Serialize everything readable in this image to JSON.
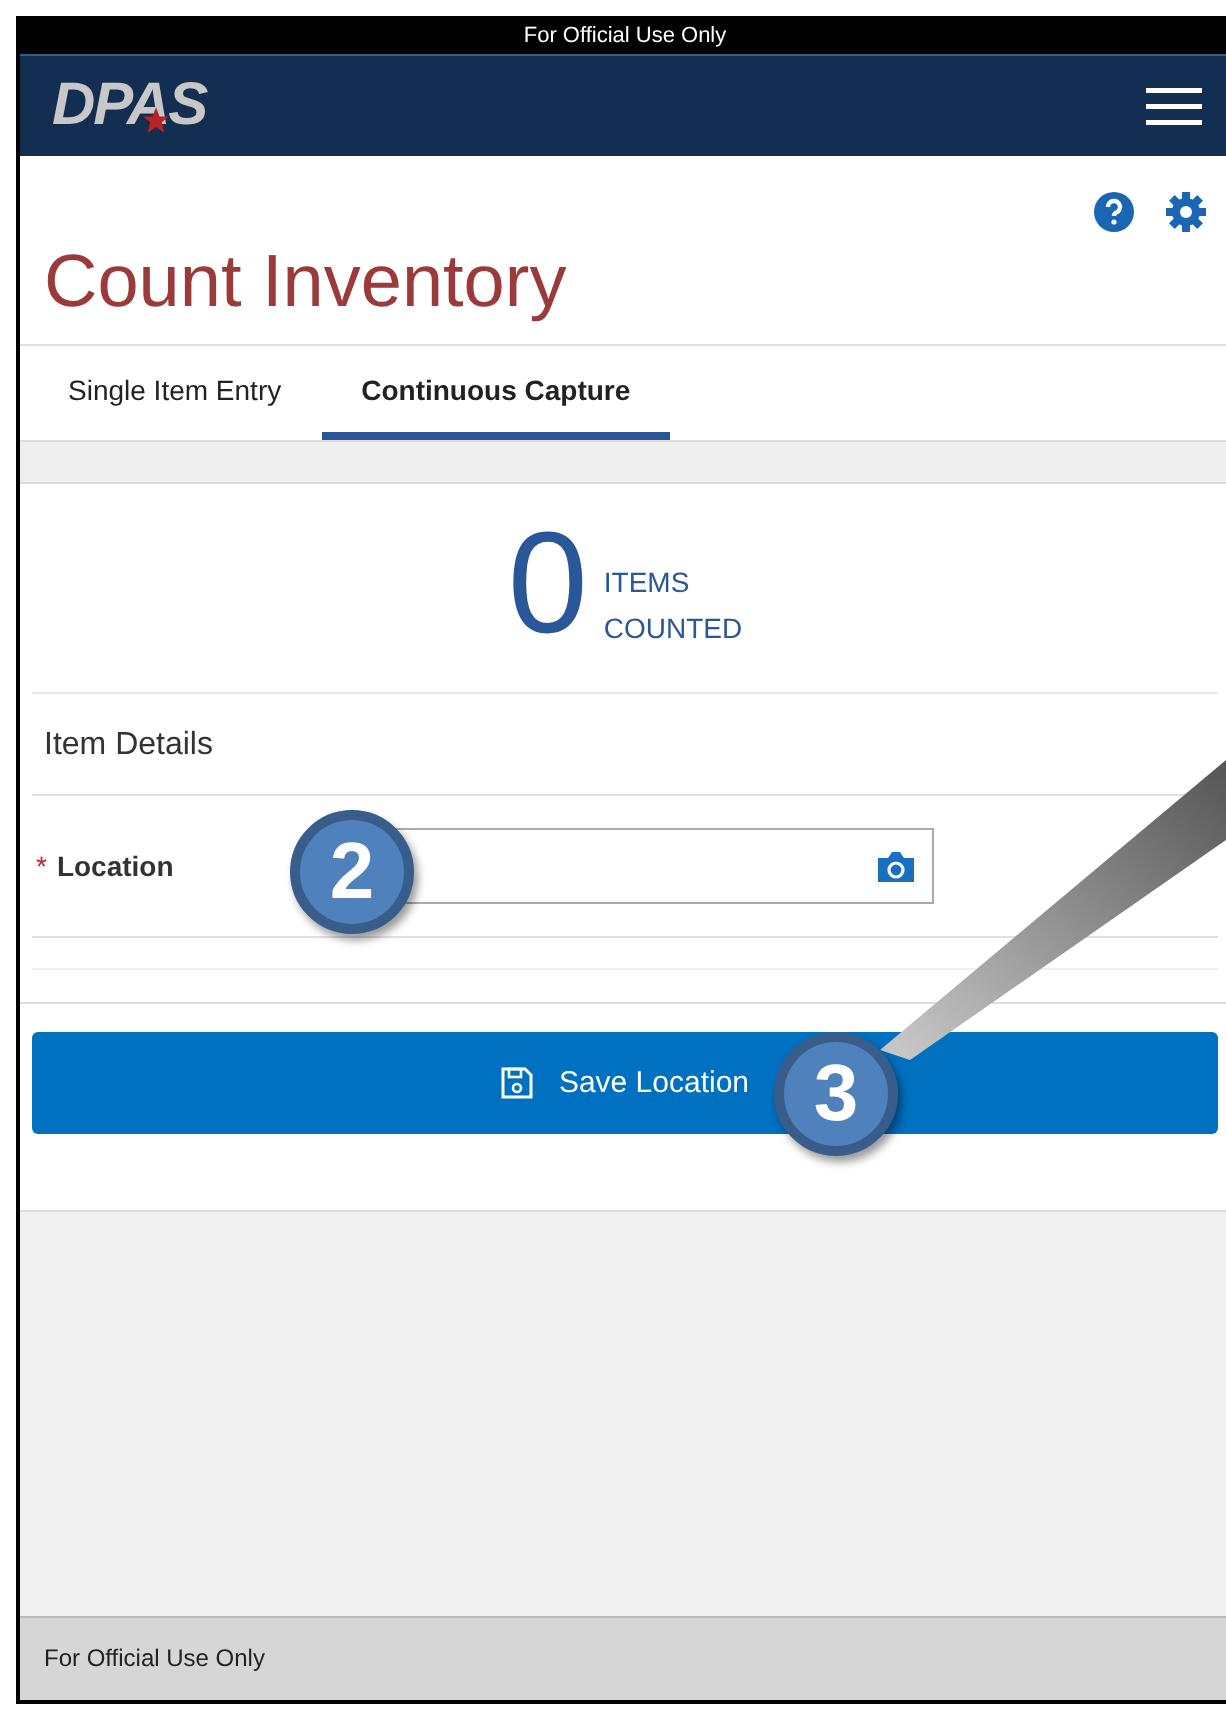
{
  "banner": "For Official Use Only",
  "header": {
    "logo": "DPAS"
  },
  "page": {
    "title": "Count Inventory"
  },
  "tabs": [
    {
      "label": "Single Item Entry",
      "selected": false
    },
    {
      "label": "Continuous Capture",
      "selected": true
    }
  ],
  "counter": {
    "value": "0",
    "label_1": "ITEMS",
    "label_2": "COUNTED"
  },
  "section": {
    "title": "Item Details"
  },
  "fields": [
    {
      "label": "Location",
      "required": true,
      "required_mark": "*"
    }
  ],
  "button": {
    "label": "Save Location"
  },
  "callouts": [
    "2",
    "3"
  ],
  "footer": "For Official Use Only"
}
